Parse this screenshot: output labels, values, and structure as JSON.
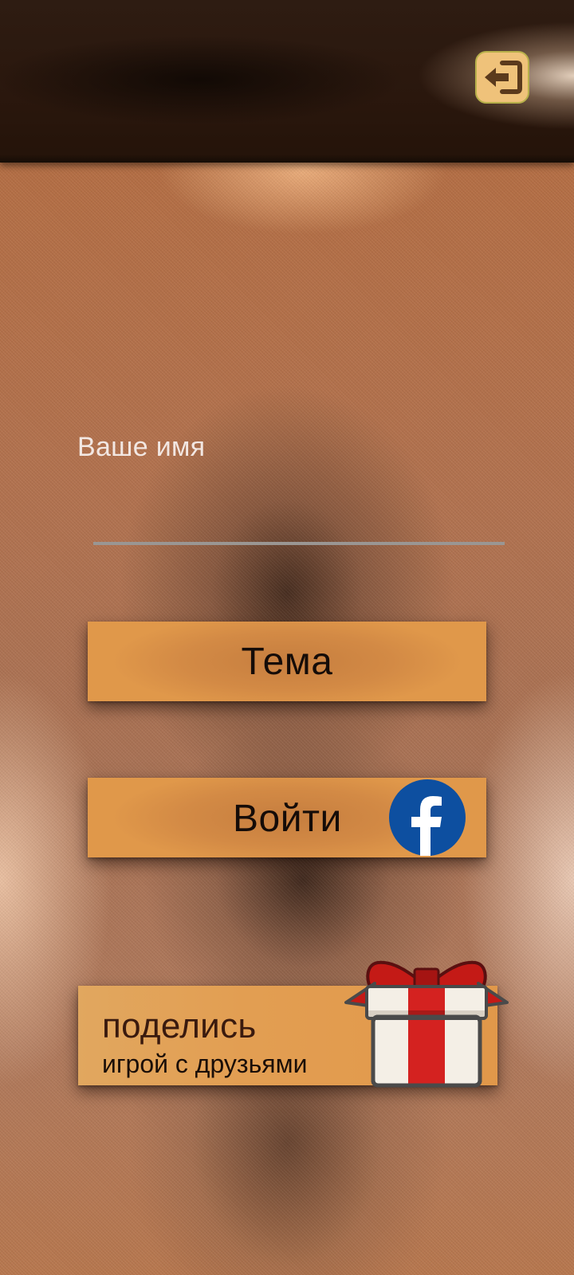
{
  "header": {
    "exit_icon": "exit-door-arrow-icon",
    "exit_button_color": "#efc27a"
  },
  "name_form": {
    "label": "Ваше имя",
    "value": "",
    "placeholder": "",
    "underline_color": "#9a9693"
  },
  "theme_button": {
    "label": "Тема",
    "color": "#d38a45"
  },
  "login_button": {
    "label": "Войти",
    "icon": "facebook-icon",
    "icon_color": "#0d4fa0"
  },
  "share_button": {
    "title": "поделись",
    "subtitle": "игрой с друзьями",
    "icon": "gift-icon",
    "gift_ribbon_color": "#d42220"
  }
}
